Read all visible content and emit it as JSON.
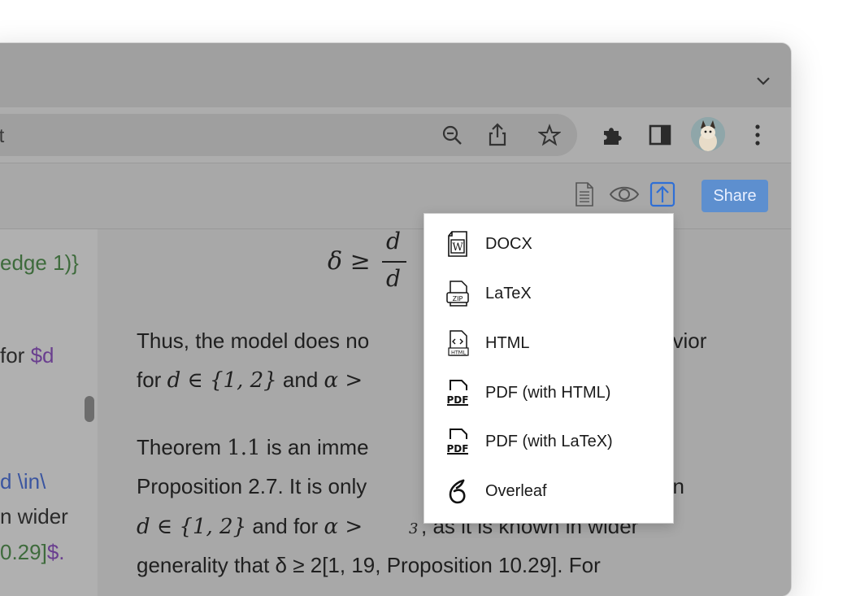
{
  "browser": {
    "address_text": "dit"
  },
  "app": {
    "share_label": "Share"
  },
  "editor": {
    "lines": [
      {
        "text": "edge 1)}",
        "color": "#3e6b3c"
      },
      {
        "text": "for ",
        "color": "#2a2a2a"
      },
      {
        "text": "$d",
        "color": "#6a3f8f"
      },
      {
        "text": "d \\in\\",
        "color": "#3a55a0"
      },
      {
        "text": "n wider",
        "color": "#2a2a2a"
      },
      {
        "text": "0.29]",
        "color": "#3e6b3c"
      },
      {
        "text": "$.",
        "color": "#6a3f8f"
      }
    ]
  },
  "preview": {
    "eq_lhs": "δ ≥",
    "eq_frac_num": "d",
    "eq_frac_den": "d",
    "para1_line1_a": "Thus, the model does no",
    "para1_line1_b": "avior",
    "para1_line2_a": "for ",
    "para1_line2_math": "d ∈ {1, 2}",
    "para1_line2_b": " and ",
    "para1_line2_math2": "α >",
    "para2_line1_a": "Theorem ",
    "para2_line1_num": "1.1",
    "para2_line1_b": " is an imme",
    "para2_line2_a": "Proposition 2.7. It is only",
    "para2_line2_b": "on",
    "para2_line3_math": "d ∈ {1, 2}",
    "para2_line3_a": " and for ",
    "para2_line3_math2": "α >",
    "para2_line3_frac_den": "3",
    "para2_line3_b": ", as it is known in wider",
    "para2_line4": "generality that δ ≥ 2[1, 19, Proposition 10.29]. For"
  },
  "export_menu": {
    "items": [
      {
        "label": "DOCX",
        "icon": "docx-file-icon"
      },
      {
        "label": "LaTeX",
        "icon": "zip-file-icon"
      },
      {
        "label": "HTML",
        "icon": "html-file-icon"
      },
      {
        "label": "PDF (with HTML)",
        "icon": "pdf-file-icon"
      },
      {
        "label": "PDF (with LaTeX)",
        "icon": "pdf-file-icon"
      },
      {
        "label": "Overleaf",
        "icon": "overleaf-icon"
      }
    ]
  },
  "colors": {
    "share_button": "#5d8fcf",
    "export_icon_active": "#2f6fd6"
  }
}
